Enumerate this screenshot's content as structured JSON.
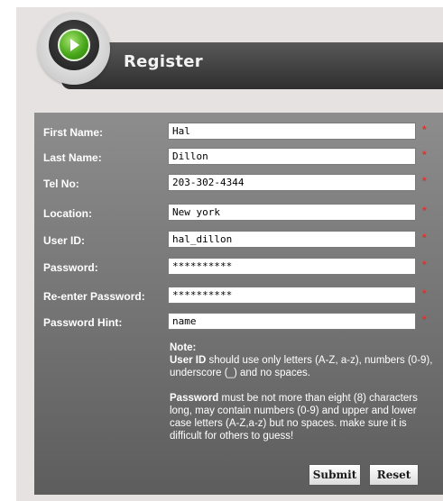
{
  "header": {
    "title": "Register",
    "logo_icon": "green-play-icon"
  },
  "colors": {
    "page_background": "#e6e2e1",
    "header_bar": "#3b3b3b",
    "form_panel": "#767676",
    "required_star": "#e4302a",
    "logo_green": "#48a81a"
  },
  "form": {
    "fields": [
      {
        "label": "First Name:",
        "value": "Hal",
        "type": "text"
      },
      {
        "label": "Last Name:",
        "value": "Dillon",
        "type": "text"
      },
      {
        "label": "Tel No:",
        "value": "203-302-4344",
        "type": "text"
      },
      {
        "label": "Location:",
        "value": "New york",
        "type": "text"
      },
      {
        "label": "User ID:",
        "value": "hal_dillon",
        "type": "text"
      },
      {
        "label": "Password:",
        "value": "**********",
        "type": "password"
      },
      {
        "label": "Re-enter Password:",
        "value": "**********",
        "type": "password"
      },
      {
        "label": "Password Hint:",
        "value": "name",
        "type": "text"
      }
    ],
    "required_mark": "*"
  },
  "note": {
    "heading": "Note:",
    "userid_term": "User ID",
    "userid_text": " should use only letters (A-Z, a-z), numbers (0-9), underscore (_) and no spaces.",
    "password_term": "Password",
    "password_text": " must be not more than eight (8) characters long, may contain numbers (0-9) and upper and lower case letters (A-Z,a-z) but no spaces. make sure it is difficult for others to guess!"
  },
  "buttons": {
    "submit": "Submit",
    "reset": "Reset"
  }
}
